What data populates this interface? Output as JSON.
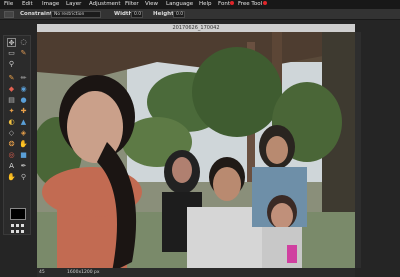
{
  "menu": {
    "items": [
      "File",
      "Edit",
      "Image",
      "Layer",
      "Adjustment",
      "Filter",
      "View",
      "Language",
      "Help",
      "Font",
      "Free Tool"
    ]
  },
  "options": {
    "constraint_label": "Constraint:",
    "constraint_value": "No restriction",
    "width_label": "Width:",
    "width_value": "0.0",
    "height_label": "Height:",
    "height_value": "0.0"
  },
  "document": {
    "title": "20170626_170042"
  },
  "status": {
    "zoom": "45",
    "size": "1600x1200 px"
  },
  "colors": {
    "accent_dot": "#e0262a",
    "foreground": "#000000"
  }
}
